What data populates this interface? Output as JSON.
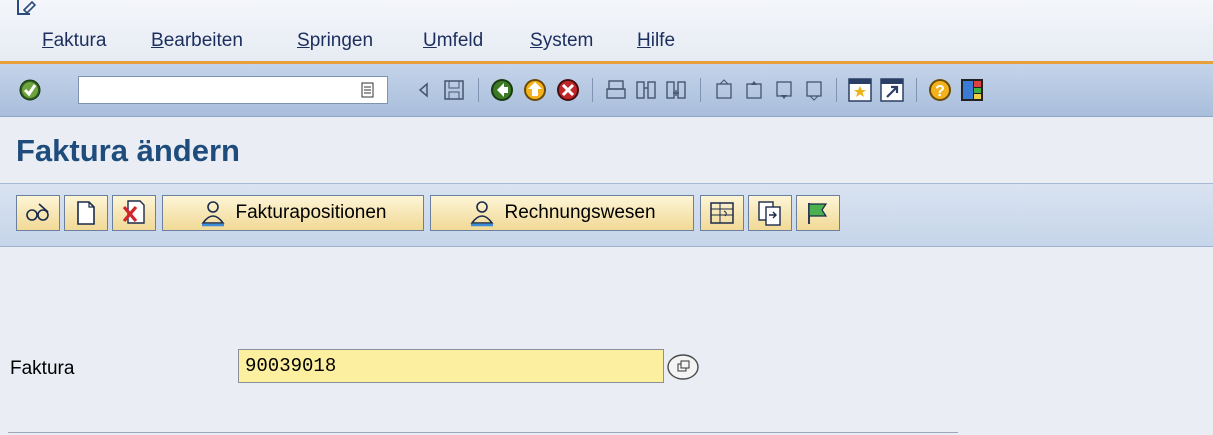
{
  "menu": {
    "items": [
      "Faktura",
      "Bearbeiten",
      "Springen",
      "Umfeld",
      "System",
      "Hilfe"
    ]
  },
  "toolbar": {
    "command_value": "",
    "icons": [
      "enter-check-icon",
      "dropdown-list-icon",
      "back-arrow-icon",
      "save-icon",
      "back-green-icon",
      "exit-yellow-icon",
      "cancel-red-icon",
      "print-icon",
      "find-icon",
      "find-next-icon",
      "first-page-icon",
      "prev-page-icon",
      "next-page-icon",
      "last-page-icon",
      "create-session-icon",
      "shortcut-icon",
      "help-icon",
      "layout-menu-icon"
    ]
  },
  "page": {
    "title": "Faktura ändern"
  },
  "app_toolbar": {
    "fakturapositionen": "Fakturapositionen",
    "rechnungswesen": "Rechnungswesen"
  },
  "form": {
    "faktura_label": "Faktura",
    "faktura_value": "90039018"
  },
  "colors": {
    "title": "#1e4c7c",
    "accent": "#e8a13a",
    "input_bg": "#fcefa0"
  }
}
